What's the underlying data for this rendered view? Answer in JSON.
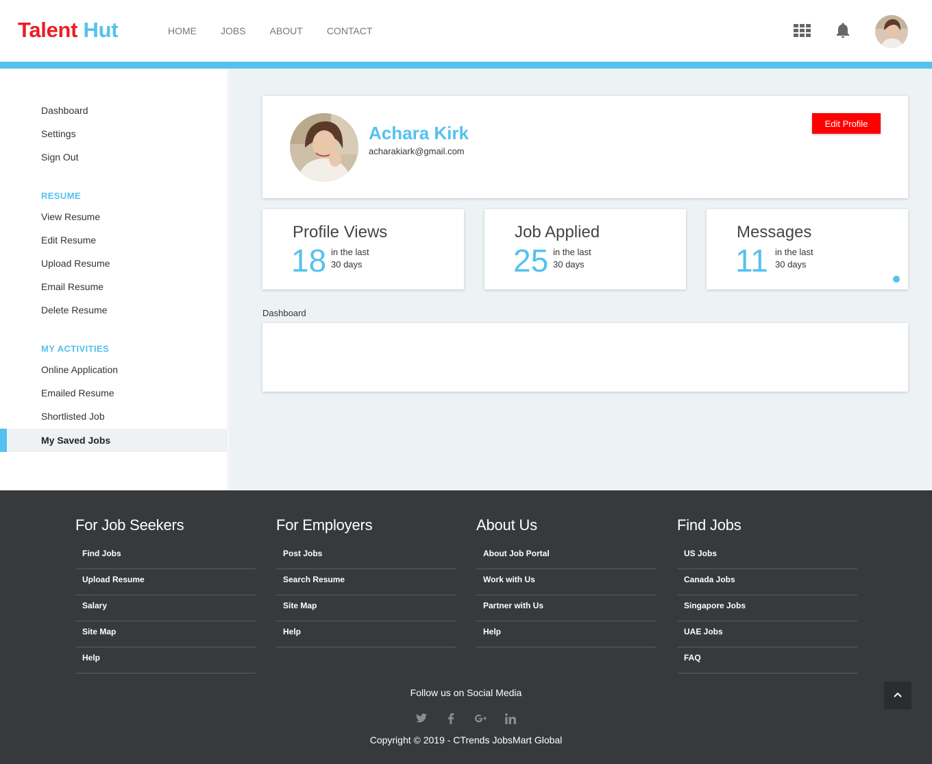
{
  "brand": {
    "part1": "Talent",
    "part2": "Hut"
  },
  "nav": [
    "HOME",
    "JOBS",
    "ABOUT",
    "CONTACT"
  ],
  "header_icons": [
    "apps-grid-icon",
    "bell-icon",
    "user-avatar"
  ],
  "sidebar": {
    "top_items": [
      "Dashboard",
      "Settings",
      "Sign Out"
    ],
    "resume_heading": "RESUME",
    "resume_items": [
      "View Resume",
      "Edit Resume",
      "Upload Resume",
      "Email Resume",
      "Delete Resume"
    ],
    "activities_heading": "MY ACTIVITIES",
    "activities_items": [
      "Online Application",
      "Emailed Resume",
      "Shortlisted Job"
    ],
    "active_item": "My Saved Jobs"
  },
  "profile": {
    "name": "Achara Kirk",
    "email": "acharakiark@gmail.com",
    "edit_label": "Edit Profile"
  },
  "stats": [
    {
      "title": "Profile Views",
      "value": "18",
      "sub1": "in the last",
      "sub2": "30 days"
    },
    {
      "title": "Job Applied",
      "value": "25",
      "sub1": "in the last",
      "sub2": "30 days"
    },
    {
      "title": "Messages",
      "value": "11",
      "sub1": "in the last",
      "sub2": "30 days"
    }
  ],
  "dashboard_label": "Dashboard",
  "footer": {
    "columns": [
      {
        "title": "For Job Seekers",
        "links": [
          "Find Jobs",
          "Upload Resume",
          "Salary",
          "Site Map",
          "Help"
        ]
      },
      {
        "title": "For Employers",
        "links": [
          "Post Jobs",
          "Search Resume",
          "Site Map",
          "Help"
        ]
      },
      {
        "title": "About Us",
        "links": [
          "About Job Portal",
          "Work with Us",
          "Partner with Us",
          "Help"
        ]
      },
      {
        "title": "Find Jobs",
        "links": [
          "US Jobs",
          "Canada Jobs",
          "Singapore Jobs",
          "UAE Jobs",
          "FAQ"
        ]
      }
    ],
    "follow": "Follow us on Social Media",
    "social": [
      "twitter-icon",
      "facebook-icon",
      "google-plus-icon",
      "linkedin-icon"
    ],
    "copyright": "Copyright © 2019 - CTrends JobsMart Global"
  },
  "colors": {
    "brand_red": "#ee1c25",
    "accent_blue": "#55c1ef",
    "button_red": "#ff0000",
    "footer_bg": "#37393c"
  }
}
